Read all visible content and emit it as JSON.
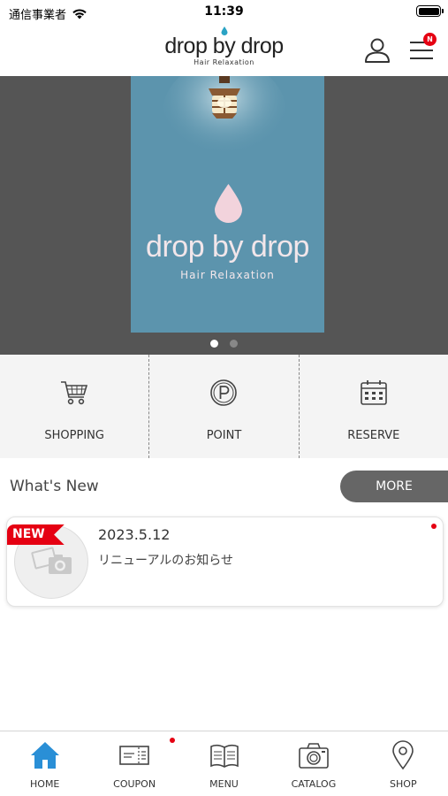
{
  "status_bar": {
    "carrier": "通信事業者",
    "time": "11:39"
  },
  "header": {
    "logo_text": "drop by drop",
    "logo_subtitle": "Hair Relaxation",
    "menu_badge": "N"
  },
  "hero": {
    "slide_title": "drop by drop",
    "slide_subtitle": "Hair Relaxation",
    "slide_count": 2,
    "active_slide": 1
  },
  "quick_menu": [
    {
      "label": "SHOPPING",
      "icon": "cart-icon"
    },
    {
      "label": "POINT",
      "icon": "point-icon"
    },
    {
      "label": "RESERVE",
      "icon": "calendar-icon"
    }
  ],
  "news": {
    "section_title": "What's New",
    "more_label": "MORE",
    "items": [
      {
        "badge": "NEW",
        "date": "2023.5.12",
        "text": "リニューアルのお知らせ",
        "unread": true
      }
    ]
  },
  "tab_bar": [
    {
      "label": "HOME",
      "icon": "home-icon",
      "active": true
    },
    {
      "label": "COUPON",
      "icon": "coupon-icon",
      "badge_dot": true
    },
    {
      "label": "MENU",
      "icon": "book-icon"
    },
    {
      "label": "CATALOG",
      "icon": "camera-icon"
    },
    {
      "label": "SHOP",
      "icon": "map-pin-icon"
    }
  ],
  "colors": {
    "accent_red": "#e50012",
    "active_tab": "#2a8fd6",
    "hero_background": "#555555",
    "slide_background": "#5c94ad",
    "logo_drop": "#2aa3c4"
  }
}
